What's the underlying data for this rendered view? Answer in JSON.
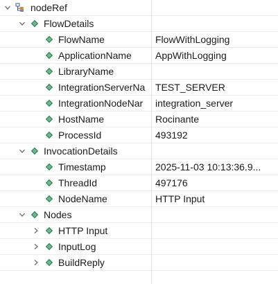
{
  "tree": {
    "rows": [
      {
        "label": "nodeRef",
        "value": "",
        "icon": "tree-structure-icon",
        "twisty": "expanded"
      },
      {
        "label": "FlowDetails",
        "value": "",
        "icon": "element-diamond-icon",
        "twisty": "expanded"
      },
      {
        "label": "FlowName",
        "value": "FlowWithLogging",
        "icon": "element-diamond-icon",
        "twisty": "none"
      },
      {
        "label": "ApplicationName",
        "value": "AppWithLogging",
        "icon": "element-diamond-icon",
        "twisty": "none"
      },
      {
        "label": "LibraryName",
        "value": "",
        "icon": "element-diamond-icon",
        "twisty": "none"
      },
      {
        "label": "IntegrationServerNa",
        "value": "TEST_SERVER",
        "icon": "element-diamond-icon",
        "twisty": "none"
      },
      {
        "label": "IntegrationNodeNar",
        "value": "integration_server",
        "icon": "element-diamond-icon",
        "twisty": "none"
      },
      {
        "label": "HostName",
        "value": "Rocinante",
        "icon": "element-diamond-icon",
        "twisty": "none"
      },
      {
        "label": "ProcessId",
        "value": "493192",
        "icon": "element-diamond-icon",
        "twisty": "none"
      },
      {
        "label": "InvocationDetails",
        "value": "",
        "icon": "element-diamond-icon",
        "twisty": "expanded"
      },
      {
        "label": "Timestamp",
        "value": "2025-11-03 10:13:36.9...",
        "icon": "element-diamond-icon",
        "twisty": "none"
      },
      {
        "label": "ThreadId",
        "value": "497176",
        "icon": "element-diamond-icon",
        "twisty": "none"
      },
      {
        "label": "NodeName",
        "value": "HTTP Input",
        "icon": "element-diamond-icon",
        "twisty": "none"
      },
      {
        "label": "Nodes",
        "value": "",
        "icon": "element-diamond-icon",
        "twisty": "expanded"
      },
      {
        "label": "HTTP Input",
        "value": "",
        "icon": "element-diamond-icon",
        "twisty": "collapsed"
      },
      {
        "label": "InputLog",
        "value": "",
        "icon": "element-diamond-icon",
        "twisty": "collapsed"
      },
      {
        "label": "BuildReply",
        "value": "",
        "icon": "element-diamond-icon",
        "twisty": "collapsed"
      }
    ]
  },
  "colors": {
    "element_icon": "#2e8b57",
    "twisty": "#6b6b6b",
    "text": "#1b1b1b"
  }
}
